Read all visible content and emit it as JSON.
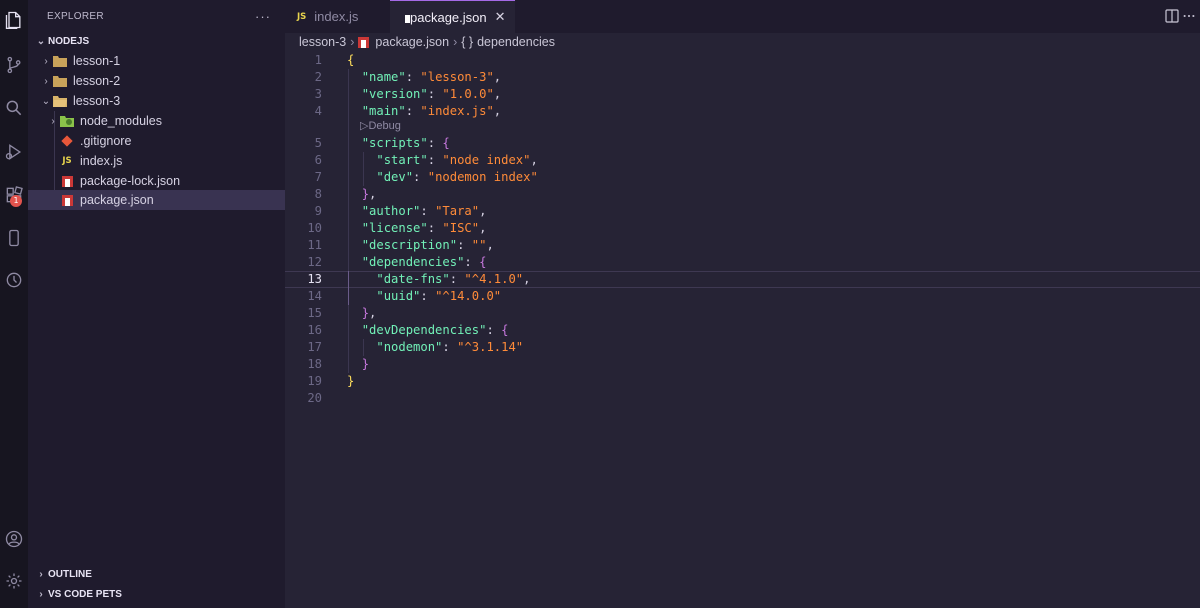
{
  "explorer": {
    "title": "EXPLORER",
    "more": "···",
    "root": "NODEJS",
    "tree": [
      {
        "label": "lesson-1",
        "type": "folder",
        "expanded": false
      },
      {
        "label": "lesson-2",
        "type": "folder",
        "expanded": false
      },
      {
        "label": "lesson-3",
        "type": "folder",
        "expanded": true
      },
      {
        "label": "node_modules",
        "type": "node-modules-folder",
        "expanded": false
      },
      {
        "label": ".gitignore",
        "type": "git-file"
      },
      {
        "label": "index.js",
        "type": "js-file"
      },
      {
        "label": "package-lock.json",
        "type": "npm-file"
      },
      {
        "label": "package.json",
        "type": "npm-file",
        "selected": true
      }
    ],
    "outline": "OUTLINE",
    "pets": "VS CODE PETS"
  },
  "activity_badge": "1",
  "tabs": [
    {
      "label": "index.js",
      "icon_text": "JS",
      "icon": "js-icon"
    },
    {
      "label": "package.json",
      "icon": "npm-icon",
      "active": true,
      "close": "✕"
    }
  ],
  "breadcrumb": {
    "folder": "lesson-3",
    "file": "package.json",
    "symbol_icon": "{ }",
    "symbol": "dependencies"
  },
  "codelens": "▷Debug",
  "colors": {
    "accent": "#a56ae6",
    "key": "#72f1b8",
    "string": "#ff8b39",
    "bracket_gold": "#fede5d",
    "bracket_purple": "#c678dd",
    "bracket_cyan": "#36f9f6",
    "npm_red": "#cb3837",
    "js_yellow": "#e8d44d"
  },
  "code": {
    "current_line": "13",
    "lines": [
      {
        "n": "1",
        "t": "{"
      },
      {
        "n": "2",
        "t": "  \"name\": \"lesson-3\","
      },
      {
        "n": "3",
        "t": "  \"version\": \"1.0.0\","
      },
      {
        "n": "4",
        "t": "  \"main\": \"index.js\","
      },
      {
        "n": "5",
        "t": "  \"scripts\": {"
      },
      {
        "n": "6",
        "t": "    \"start\": \"node index\","
      },
      {
        "n": "7",
        "t": "    \"dev\": \"nodemon index\""
      },
      {
        "n": "8",
        "t": "  },"
      },
      {
        "n": "9",
        "t": "  \"author\": \"Tara\","
      },
      {
        "n": "10",
        "t": "  \"license\": \"ISC\","
      },
      {
        "n": "11",
        "t": "  \"description\": \"\","
      },
      {
        "n": "12",
        "t": "  \"dependencies\": {"
      },
      {
        "n": "13",
        "t": "    \"date-fns\": \"^4.1.0\","
      },
      {
        "n": "14",
        "t": "    \"uuid\": \"^14.0.0\""
      },
      {
        "n": "15",
        "t": "  },"
      },
      {
        "n": "16",
        "t": "  \"devDependencies\": {"
      },
      {
        "n": "17",
        "t": "    \"nodemon\": \"^3.1.14\""
      },
      {
        "n": "18",
        "t": "  }"
      },
      {
        "n": "19",
        "t": "}"
      },
      {
        "n": "20",
        "t": ""
      }
    ]
  }
}
